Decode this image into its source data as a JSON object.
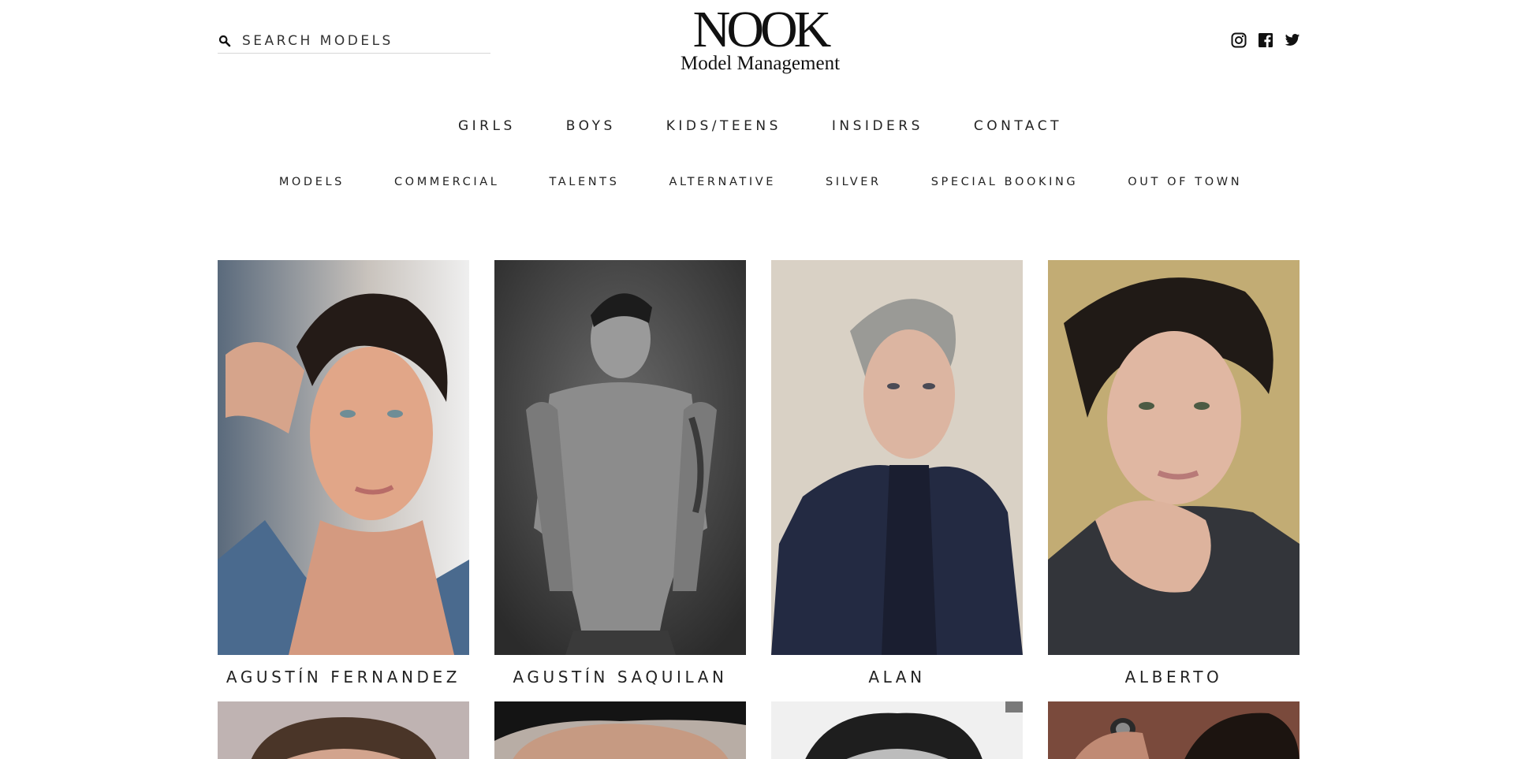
{
  "header": {
    "search": {
      "placeholder": "SEARCH MODELS",
      "icon": "search-icon"
    },
    "logo": {
      "word": "NOOK",
      "subtitle": "Model Management"
    },
    "social": [
      "instagram-icon",
      "facebook-icon",
      "twitter-icon"
    ]
  },
  "nav": {
    "primary": [
      "GIRLS",
      "BOYS",
      "KIDS/TEENS",
      "INSIDERS",
      "CONTACT"
    ],
    "secondary": [
      "MODELS",
      "COMMERCIAL",
      "TALENTS",
      "ALTERNATIVE",
      "SILVER",
      "SPECIAL BOOKING",
      "OUT OF TOWN"
    ]
  },
  "models": [
    {
      "name": "AGUSTÍN FERNANDEZ"
    },
    {
      "name": "AGUSTÍN SAQUILAN"
    },
    {
      "name": "ALAN"
    },
    {
      "name": "ALBERTO"
    }
  ],
  "colors": {
    "text": "#222222",
    "divider": "#d6d6d6",
    "background": "#ffffff"
  }
}
